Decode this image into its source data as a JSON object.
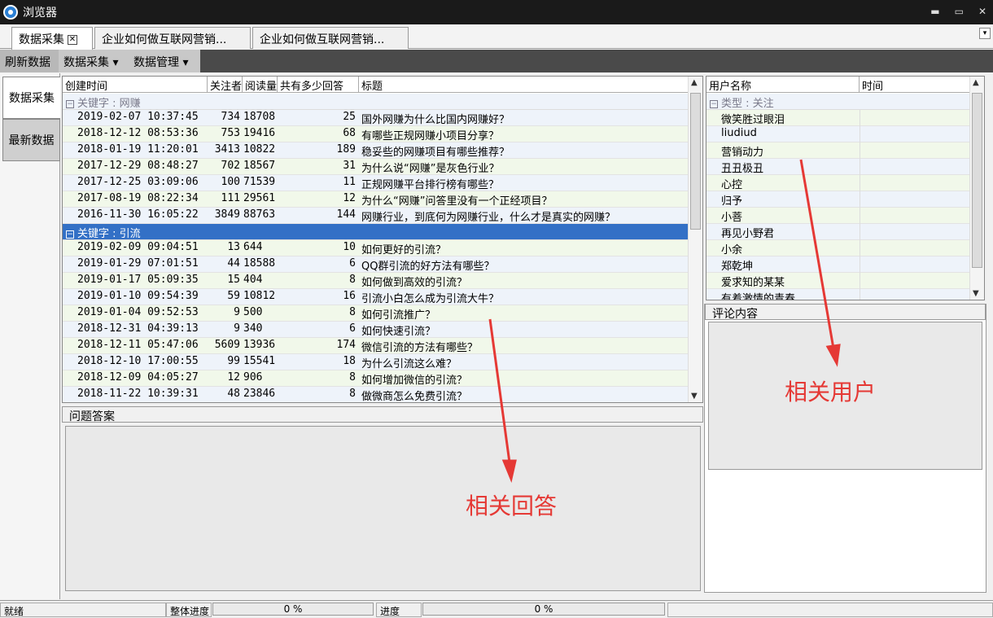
{
  "window": {
    "title": "浏览器",
    "minimize": "▬",
    "maximize": "▭",
    "close": "✕"
  },
  "tabs": [
    {
      "label": "数据采集",
      "close": "✕"
    },
    {
      "label": "企业如何做互联网营销..."
    },
    {
      "label": "企业如何做互联网营销..."
    }
  ],
  "tab_menu": "▾",
  "menubar": {
    "refresh": "刷新数据",
    "collect": "数据采集 ▾",
    "manage": "数据管理 ▾"
  },
  "leftnav": {
    "collect": "数据采集",
    "latest": "最新数据"
  },
  "grid": {
    "columns": [
      "创建时间",
      "关注者",
      "阅读量",
      "共有多少回答",
      "标题"
    ],
    "groups": [
      {
        "label": "关键字 : 网赚",
        "expander": "−",
        "rows": [
          [
            "2019-02-07 10:37:45",
            "734",
            "18708",
            "25",
            "国外网赚为什么比国内网赚好？"
          ],
          [
            "2018-12-12 08:53:36",
            "753",
            "19416",
            "68",
            "有哪些正规网赚小项目分享？"
          ],
          [
            "2018-01-19 11:20:01",
            "3413",
            "10822",
            "189",
            "稳妥些的网赚项目有哪些推荐？"
          ],
          [
            "2017-12-29 08:48:27",
            "702",
            "18567",
            "31",
            "为什么说“网赚”是灰色行业？"
          ],
          [
            "2017-12-25 03:09:06",
            "100",
            "71539",
            "11",
            "正规网赚平台排行榜有哪些？"
          ],
          [
            "2017-08-19 08:22:34",
            "111",
            "29561",
            "12",
            "为什么“网赚”问答里没有一个正经项目？"
          ],
          [
            "2016-11-30 16:05:22",
            "3849",
            "88763",
            "144",
            "网赚行业，到底何为网赚行业，什么才是真实的网赚？"
          ]
        ]
      },
      {
        "label": "关键字 : 引流",
        "expander": "−",
        "rows": [
          [
            "2019-02-09 09:04:51",
            "13",
            "644",
            "10",
            "如何更好的引流？"
          ],
          [
            "2019-01-29 07:01:51",
            "44",
            "18588",
            "6",
            "QQ群引流的好方法有哪些？"
          ],
          [
            "2019-01-17 05:09:35",
            "15",
            "404",
            "8",
            "如何做到高效的引流？"
          ],
          [
            "2019-01-10 09:54:39",
            "59",
            "10812",
            "16",
            "引流小白怎么成为引流大牛？"
          ],
          [
            "2019-01-04 09:52:53",
            "9",
            "500",
            "8",
            "如何引流推广？"
          ],
          [
            "2018-12-31 04:39:13",
            "9",
            "340",
            "6",
            "如何快速引流？"
          ],
          [
            "2018-12-11 05:47:06",
            "5609",
            "13936",
            "174",
            "微信引流的方法有哪些？"
          ],
          [
            "2018-12-10 17:00:55",
            "99",
            "15541",
            "18",
            "为什么引流这么难？"
          ],
          [
            "2018-12-09 04:05:27",
            "12",
            "906",
            "8",
            "如何增加微信的引流？"
          ],
          [
            "2018-11-22 10:39:31",
            "48",
            "23846",
            "8",
            "做微商怎么免费引流？"
          ]
        ]
      }
    ]
  },
  "answers_panel": {
    "title": "问题答案"
  },
  "users": {
    "columns": [
      "用户名称",
      "时间"
    ],
    "group": {
      "label": "类型 : 关注",
      "expander": "−"
    },
    "rows": [
      "微笑胜过眼泪",
      "liudiud",
      "营销动力",
      "丑丑极丑",
      "心控",
      "归予",
      "小菩",
      "再见小野君",
      "小余",
      "郑乾坤",
      "爱求知的某某",
      "有着激情的青春"
    ]
  },
  "comment_panel": {
    "title": "评论内容"
  },
  "statusbar": {
    "ready": "就绪",
    "overall_label": "整体进度",
    "overall_value": "0 %",
    "progress_label": "进度",
    "progress_value": "0 %",
    "overall_fraction": 0,
    "progress_fraction": 0
  },
  "annotations": {
    "answers": "相关回答",
    "users": "相关用户",
    "color": "#e53935"
  }
}
